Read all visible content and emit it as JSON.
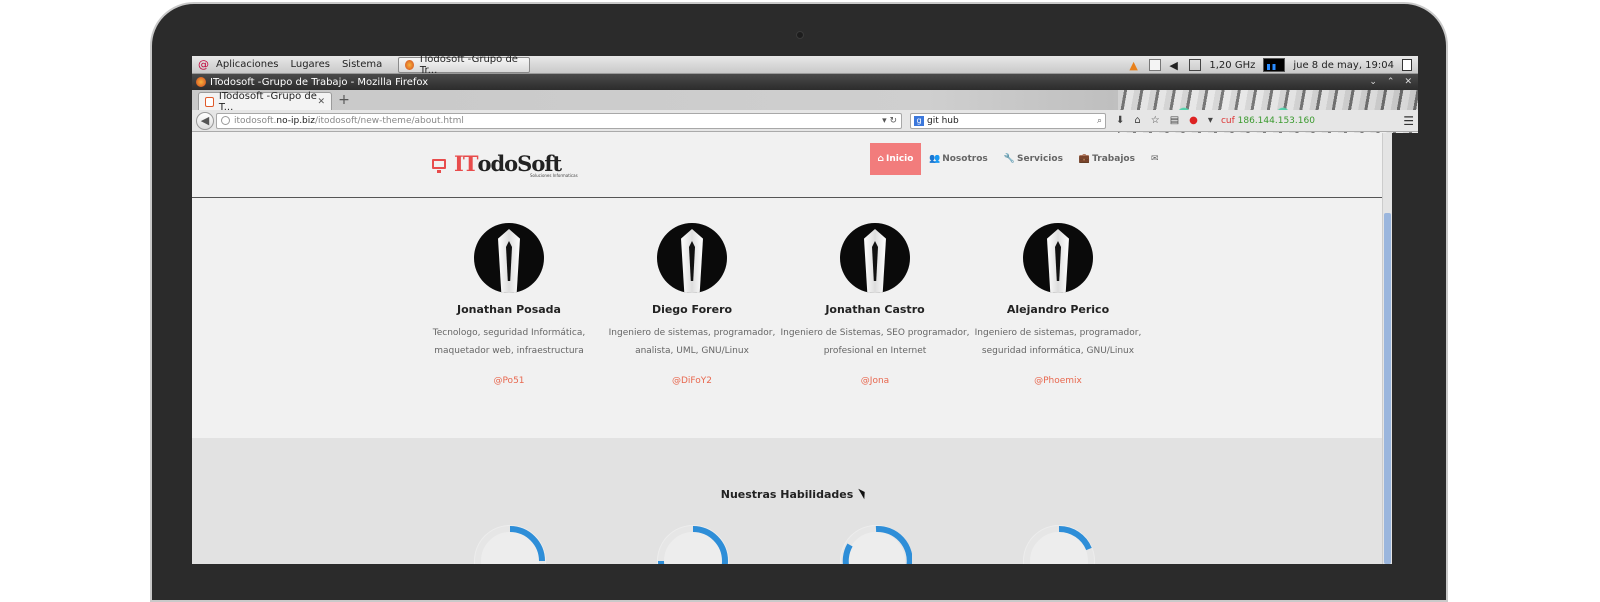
{
  "gnome_panel": {
    "menus": [
      "Aplicaciones",
      "Lugares",
      "Sistema"
    ],
    "task_label": "ITodosoft -Grupo de Tr...",
    "cpu_freq": "1,20 GHz",
    "clock": "jue  8 de may, 19:04"
  },
  "window": {
    "title": "ITodosoft -Grupo de Trabajo - Mozilla Firefox"
  },
  "browser": {
    "tab_label": "ITodosoft -Grupo de T...",
    "url_prefix": "itodosoft.",
    "url_host": "no-ip.biz",
    "url_path": "/itodosoft/new-theme/about.html",
    "search_value": "git hub",
    "ip_prefix": "cuf",
    "ip_value": "186.144.153.160"
  },
  "site": {
    "logo_it": "IT",
    "logo_rest": "odoSoft",
    "logo_tagline": "Soluciones Informaticas",
    "nav": [
      {
        "icon": "⌂",
        "label": "Inicio"
      },
      {
        "icon": "👥",
        "label": "Nosotros"
      },
      {
        "icon": "🔧",
        "label": "Servicios"
      },
      {
        "icon": "💼",
        "label": "Trabajos"
      },
      {
        "icon": "✉",
        "label": ""
      }
    ],
    "team": [
      {
        "name": "Jonathan Posada",
        "desc": "Tecnologo, seguridad Informática, maquetador web, infraestructura",
        "handle": "@Po51"
      },
      {
        "name": "Diego Forero",
        "desc": "Ingeniero de sistemas, programador, analista, UML, GNU/Linux",
        "handle": "@DiFoY2"
      },
      {
        "name": "Jonathan Castro",
        "desc": "Ingeniero de Sistemas, SEO programador, profesional en Internet",
        "handle": "@Jona"
      },
      {
        "name": "Alejandro Perico",
        "desc": "Ingeniero de sistemas, programador, seguridad informática, GNU/Linux",
        "handle": "@Phoemix"
      }
    ],
    "skills_title": "Nuestras Habilidades",
    "ring_color": "#2e8ed8"
  }
}
